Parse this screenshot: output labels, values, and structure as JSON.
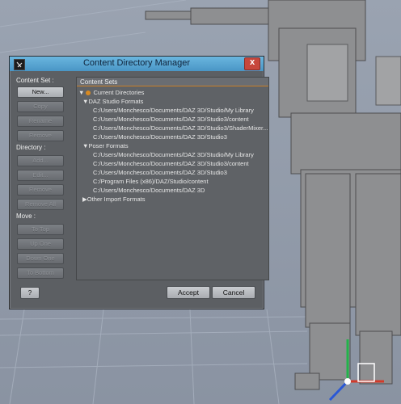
{
  "dialog": {
    "title": "Content Directory Manager",
    "close_label": "x",
    "content_set_label": "Content Set :",
    "directory_label": "Directory :",
    "move_label": "Move :",
    "content_set_buttons": [
      "New...",
      "Copy",
      "Rename",
      "Remove"
    ],
    "directory_buttons": [
      "Add...",
      "Edit...",
      "Remove",
      "Remove All"
    ],
    "move_buttons": [
      "To Top",
      "Up One",
      "Down One",
      "To Bottom"
    ],
    "content_sets_header": "Content Sets",
    "tree": {
      "root": "Current Directories",
      "daz_group": "DAZ Studio Formats",
      "daz_paths": [
        "C:/Users/Monchesco/Documents/DAZ 3D/Studio/My Library",
        "C:/Users/Monchesco/Documents/DAZ 3D/Studio3/content",
        "C:/Users/Monchesco/Documents/DAZ 3D/Studio3/ShaderMixer...",
        "C:/Users/Monchesco/Documents/DAZ 3D/Studio3"
      ],
      "poser_group": "Poser Formats",
      "poser_paths": [
        "C:/Users/Monchesco/Documents/DAZ 3D/Studio/My Library",
        "C:/Users/Monchesco/Documents/DAZ 3D/Studio3/content",
        "C:/Users/Monchesco/Documents/DAZ 3D/Studio3",
        "C:/Program Files (x86)/DAZ/Studio/content",
        "C:/Users/Monchesco/Documents/DAZ 3D"
      ],
      "other_group": "Other Import Formats"
    },
    "help_label": "?",
    "accept_label": "Accept",
    "cancel_label": "Cancel"
  },
  "colors": {
    "dialog_bg": "#5c5f63",
    "titlebar": "#5aa6d4",
    "close": "#c7473c",
    "accent": "#d88a22"
  }
}
